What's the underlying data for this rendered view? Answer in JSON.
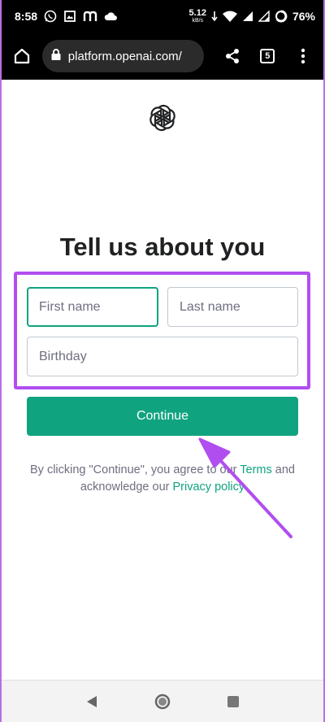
{
  "status_bar": {
    "time": "8:58",
    "net_speed_value": "5.12",
    "net_speed_unit": "kB/s",
    "battery": "76%",
    "icons": [
      "whatsapp-icon",
      "gallery-icon",
      "m-icon",
      "cloud-icon",
      "wifi-icon",
      "signal-icon",
      "battery-icon"
    ]
  },
  "browser": {
    "url": "platform.openai.com/",
    "tab_count": "5"
  },
  "page": {
    "heading": "Tell us about you",
    "first_name_placeholder": "First name",
    "last_name_placeholder": "Last name",
    "birthday_placeholder": "Birthday",
    "continue_label": "Continue",
    "terms_prefix": "By clicking \"Continue\", you agree to our ",
    "terms_link": "Terms",
    "terms_middle": " and acknowledge our ",
    "privacy_link": "Privacy policy"
  },
  "colors": {
    "accent": "#10a37f",
    "highlight": "#b14ef0",
    "text": "#202123",
    "muted": "#6e6e80"
  }
}
